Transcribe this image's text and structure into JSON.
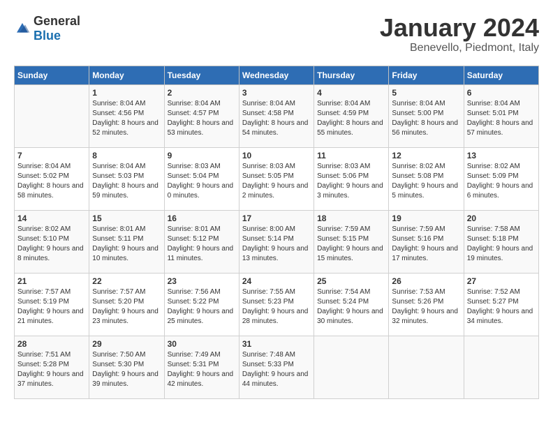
{
  "logo": {
    "general": "General",
    "blue": "Blue"
  },
  "header": {
    "month": "January 2024",
    "location": "Benevello, Piedmont, Italy"
  },
  "weekdays": [
    "Sunday",
    "Monday",
    "Tuesday",
    "Wednesday",
    "Thursday",
    "Friday",
    "Saturday"
  ],
  "weeks": [
    [
      {
        "day": "",
        "sunrise": "",
        "sunset": "",
        "daylight": ""
      },
      {
        "day": "1",
        "sunrise": "Sunrise: 8:04 AM",
        "sunset": "Sunset: 4:56 PM",
        "daylight": "Daylight: 8 hours and 52 minutes."
      },
      {
        "day": "2",
        "sunrise": "Sunrise: 8:04 AM",
        "sunset": "Sunset: 4:57 PM",
        "daylight": "Daylight: 8 hours and 53 minutes."
      },
      {
        "day": "3",
        "sunrise": "Sunrise: 8:04 AM",
        "sunset": "Sunset: 4:58 PM",
        "daylight": "Daylight: 8 hours and 54 minutes."
      },
      {
        "day": "4",
        "sunrise": "Sunrise: 8:04 AM",
        "sunset": "Sunset: 4:59 PM",
        "daylight": "Daylight: 8 hours and 55 minutes."
      },
      {
        "day": "5",
        "sunrise": "Sunrise: 8:04 AM",
        "sunset": "Sunset: 5:00 PM",
        "daylight": "Daylight: 8 hours and 56 minutes."
      },
      {
        "day": "6",
        "sunrise": "Sunrise: 8:04 AM",
        "sunset": "Sunset: 5:01 PM",
        "daylight": "Daylight: 8 hours and 57 minutes."
      }
    ],
    [
      {
        "day": "7",
        "sunrise": "Sunrise: 8:04 AM",
        "sunset": "Sunset: 5:02 PM",
        "daylight": "Daylight: 8 hours and 58 minutes."
      },
      {
        "day": "8",
        "sunrise": "Sunrise: 8:04 AM",
        "sunset": "Sunset: 5:03 PM",
        "daylight": "Daylight: 8 hours and 59 minutes."
      },
      {
        "day": "9",
        "sunrise": "Sunrise: 8:03 AM",
        "sunset": "Sunset: 5:04 PM",
        "daylight": "Daylight: 9 hours and 0 minutes."
      },
      {
        "day": "10",
        "sunrise": "Sunrise: 8:03 AM",
        "sunset": "Sunset: 5:05 PM",
        "daylight": "Daylight: 9 hours and 2 minutes."
      },
      {
        "day": "11",
        "sunrise": "Sunrise: 8:03 AM",
        "sunset": "Sunset: 5:06 PM",
        "daylight": "Daylight: 9 hours and 3 minutes."
      },
      {
        "day": "12",
        "sunrise": "Sunrise: 8:02 AM",
        "sunset": "Sunset: 5:08 PM",
        "daylight": "Daylight: 9 hours and 5 minutes."
      },
      {
        "day": "13",
        "sunrise": "Sunrise: 8:02 AM",
        "sunset": "Sunset: 5:09 PM",
        "daylight": "Daylight: 9 hours and 6 minutes."
      }
    ],
    [
      {
        "day": "14",
        "sunrise": "Sunrise: 8:02 AM",
        "sunset": "Sunset: 5:10 PM",
        "daylight": "Daylight: 9 hours and 8 minutes."
      },
      {
        "day": "15",
        "sunrise": "Sunrise: 8:01 AM",
        "sunset": "Sunset: 5:11 PM",
        "daylight": "Daylight: 9 hours and 10 minutes."
      },
      {
        "day": "16",
        "sunrise": "Sunrise: 8:01 AM",
        "sunset": "Sunset: 5:12 PM",
        "daylight": "Daylight: 9 hours and 11 minutes."
      },
      {
        "day": "17",
        "sunrise": "Sunrise: 8:00 AM",
        "sunset": "Sunset: 5:14 PM",
        "daylight": "Daylight: 9 hours and 13 minutes."
      },
      {
        "day": "18",
        "sunrise": "Sunrise: 7:59 AM",
        "sunset": "Sunset: 5:15 PM",
        "daylight": "Daylight: 9 hours and 15 minutes."
      },
      {
        "day": "19",
        "sunrise": "Sunrise: 7:59 AM",
        "sunset": "Sunset: 5:16 PM",
        "daylight": "Daylight: 9 hours and 17 minutes."
      },
      {
        "day": "20",
        "sunrise": "Sunrise: 7:58 AM",
        "sunset": "Sunset: 5:18 PM",
        "daylight": "Daylight: 9 hours and 19 minutes."
      }
    ],
    [
      {
        "day": "21",
        "sunrise": "Sunrise: 7:57 AM",
        "sunset": "Sunset: 5:19 PM",
        "daylight": "Daylight: 9 hours and 21 minutes."
      },
      {
        "day": "22",
        "sunrise": "Sunrise: 7:57 AM",
        "sunset": "Sunset: 5:20 PM",
        "daylight": "Daylight: 9 hours and 23 minutes."
      },
      {
        "day": "23",
        "sunrise": "Sunrise: 7:56 AM",
        "sunset": "Sunset: 5:22 PM",
        "daylight": "Daylight: 9 hours and 25 minutes."
      },
      {
        "day": "24",
        "sunrise": "Sunrise: 7:55 AM",
        "sunset": "Sunset: 5:23 PM",
        "daylight": "Daylight: 9 hours and 28 minutes."
      },
      {
        "day": "25",
        "sunrise": "Sunrise: 7:54 AM",
        "sunset": "Sunset: 5:24 PM",
        "daylight": "Daylight: 9 hours and 30 minutes."
      },
      {
        "day": "26",
        "sunrise": "Sunrise: 7:53 AM",
        "sunset": "Sunset: 5:26 PM",
        "daylight": "Daylight: 9 hours and 32 minutes."
      },
      {
        "day": "27",
        "sunrise": "Sunrise: 7:52 AM",
        "sunset": "Sunset: 5:27 PM",
        "daylight": "Daylight: 9 hours and 34 minutes."
      }
    ],
    [
      {
        "day": "28",
        "sunrise": "Sunrise: 7:51 AM",
        "sunset": "Sunset: 5:28 PM",
        "daylight": "Daylight: 9 hours and 37 minutes."
      },
      {
        "day": "29",
        "sunrise": "Sunrise: 7:50 AM",
        "sunset": "Sunset: 5:30 PM",
        "daylight": "Daylight: 9 hours and 39 minutes."
      },
      {
        "day": "30",
        "sunrise": "Sunrise: 7:49 AM",
        "sunset": "Sunset: 5:31 PM",
        "daylight": "Daylight: 9 hours and 42 minutes."
      },
      {
        "day": "31",
        "sunrise": "Sunrise: 7:48 AM",
        "sunset": "Sunset: 5:33 PM",
        "daylight": "Daylight: 9 hours and 44 minutes."
      },
      {
        "day": "",
        "sunrise": "",
        "sunset": "",
        "daylight": ""
      },
      {
        "day": "",
        "sunrise": "",
        "sunset": "",
        "daylight": ""
      },
      {
        "day": "",
        "sunrise": "",
        "sunset": "",
        "daylight": ""
      }
    ]
  ]
}
